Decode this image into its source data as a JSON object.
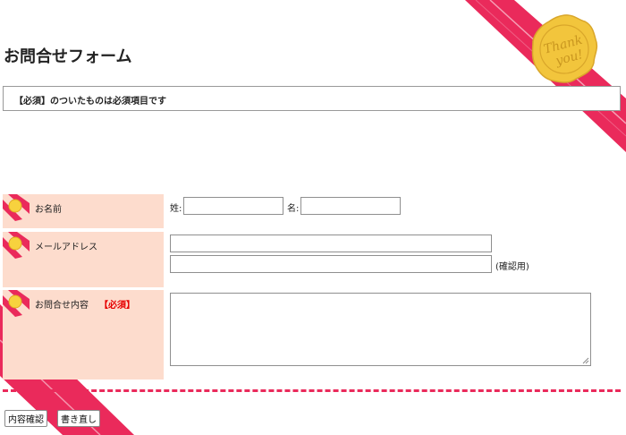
{
  "page": {
    "title": "お問合せフォーム"
  },
  "notice": {
    "text": "【必須】のついたものは必須項目です"
  },
  "seal": {
    "text_line1": "Thank",
    "text_line2": "you!"
  },
  "form": {
    "name_row": {
      "label": "お名前",
      "last_name_label": "姓:",
      "first_name_label": "名:",
      "last_name_value": "",
      "first_name_value": ""
    },
    "email_row": {
      "label": "メールアドレス",
      "email_value": "",
      "email_confirm_value": "",
      "confirm_note": "(確認用)"
    },
    "inquiry_row": {
      "label": "お問合せ内容",
      "required_mark": "【必須】",
      "inquiry_value": ""
    }
  },
  "buttons": {
    "confirm_label": "内容確認",
    "reset_label": "書き直し"
  },
  "colors": {
    "ribbon": "#ea2a5b",
    "label_bg": "#fddccd",
    "required": "#e60000",
    "seal": "#f2c53c"
  }
}
